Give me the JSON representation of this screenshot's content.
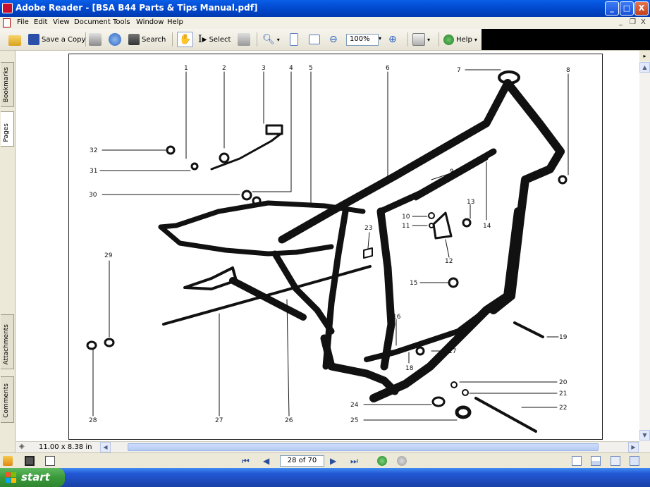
{
  "window": {
    "title": "Adobe Reader - [BSA B44 Parts & Tips Manual.pdf]",
    "controls": {
      "minimize": "_",
      "maximize": "□",
      "close": "X"
    }
  },
  "menubar": {
    "items": [
      "File",
      "Edit",
      "View",
      "Document",
      "Tools",
      "Window",
      "Help"
    ],
    "doc_controls": {
      "minimize": "_",
      "restore": "❐",
      "close": "X"
    }
  },
  "toolbar": {
    "save_copy_label": "Save a Copy",
    "search_label": "Search",
    "select_label": "Select",
    "zoom_value": "100%",
    "help_label": "Help"
  },
  "navpane": {
    "tabs": [
      "Bookmarks",
      "Pages",
      "Attachments",
      "Comments"
    ]
  },
  "diagram": {
    "callouts": [
      "1",
      "2",
      "3",
      "4",
      "5",
      "6",
      "7",
      "8",
      "9",
      "10",
      "11",
      "12",
      "13",
      "14",
      "15",
      "16",
      "17",
      "18",
      "19",
      "20",
      "21",
      "22",
      "23",
      "24",
      "25",
      "26",
      "27",
      "28",
      "29",
      "30",
      "31",
      "32"
    ]
  },
  "hscroll": {
    "page_size": "11.00 x 8.38 in"
  },
  "statusbar": {
    "page_indicator": "28 of 70"
  },
  "taskbar": {
    "start_label": "start"
  },
  "colors": {
    "titlebar": "#0a5ee8",
    "menubar": "#f2efe4",
    "taskbar": "#2257d5",
    "start": "#3a9a3a"
  }
}
